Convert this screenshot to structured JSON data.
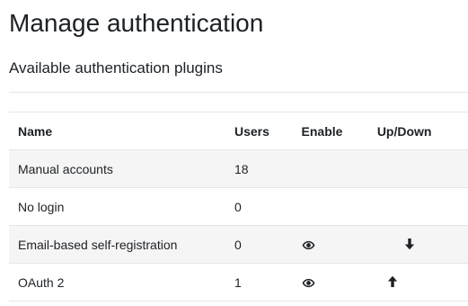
{
  "page": {
    "title": "Manage authentication",
    "section_heading": "Available authentication plugins"
  },
  "table": {
    "headers": {
      "name": "Name",
      "users": "Users",
      "enable": "Enable",
      "updown": "Up/Down"
    },
    "rows": [
      {
        "name": "Manual accounts",
        "users": "18",
        "enable_icon": "",
        "up_icon": "",
        "down_icon": ""
      },
      {
        "name": "No login",
        "users": "0",
        "enable_icon": "",
        "up_icon": "",
        "down_icon": ""
      },
      {
        "name": "Email-based self-registration",
        "users": "0",
        "enable_icon": "eye-icon",
        "up_icon": "",
        "down_icon": "arrow-down-icon"
      },
      {
        "name": "OAuth 2",
        "users": "1",
        "enable_icon": "eye-icon",
        "up_icon": "arrow-up-icon",
        "down_icon": ""
      }
    ]
  },
  "colors": {
    "text": "#1d2125",
    "row_stripe": "#f5f5f5",
    "border": "#e3e6ea"
  }
}
